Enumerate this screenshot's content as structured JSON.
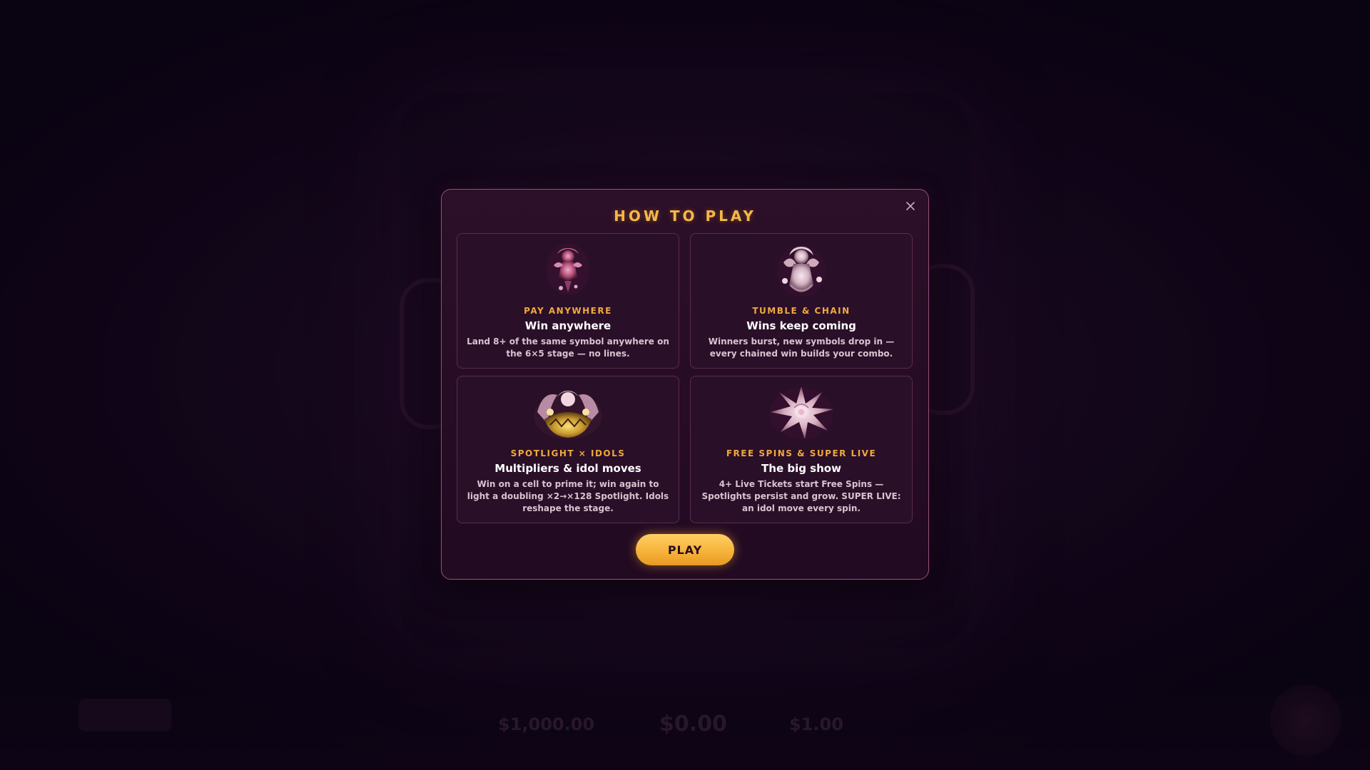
{
  "background": {
    "balance": "$1,000.00",
    "win": "$0.00",
    "bet": "$1.00"
  },
  "modal": {
    "title": "HOW TO PLAY",
    "close_icon": "close-icon",
    "cards": [
      {
        "icon": "idol-symbol-pink-icon",
        "kicker": "PAY ANYWHERE",
        "heading": "Win anywhere",
        "description": "Land 8+ of the same symbol anywhere on the 6×5 stage — no lines."
      },
      {
        "icon": "idol-symbol-white-icon",
        "kicker": "TUMBLE & CHAIN",
        "heading": "Wins keep coming",
        "description": "Winners burst, new symbols drop in — every chained win builds your combo."
      },
      {
        "icon": "idol-group-gold-icon",
        "kicker": "SPOTLIGHT × IDOLS",
        "heading": "Multipliers & idol moves",
        "description": "Win on a cell to prime it; win again to light a doubling ×2→×128 Spotlight. Idols reshape the stage."
      },
      {
        "icon": "starburst-idol-icon",
        "kicker": "FREE SPINS & SUPER LIVE",
        "heading": "The big show",
        "description": "4+ Live Tickets start Free Spins — Spotlights persist and grow. SUPER LIVE: an idol move every spin."
      }
    ],
    "play_label": "PLAY"
  },
  "colors": {
    "accent_gold": "#f5b845",
    "modal_border": "#9a4f7e",
    "modal_bg": "#2c0f28",
    "card_border": "#5a2b4f",
    "text_white": "#ffffff",
    "text_muted": "#d9c3cf"
  }
}
